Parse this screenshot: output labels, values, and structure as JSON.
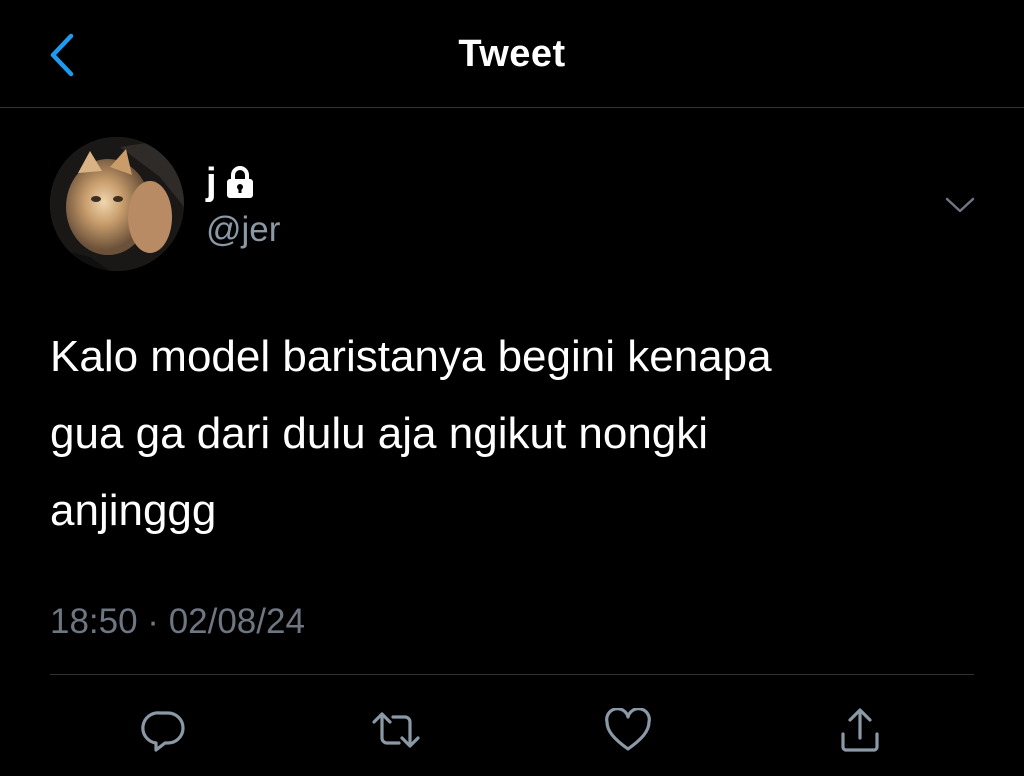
{
  "header": {
    "title": "Tweet",
    "back_icon": "chevron-left-icon",
    "accent_color": "#1d9bf0"
  },
  "tweet": {
    "display_name": "j",
    "protected_icon": "lock-icon",
    "handle": "@jer",
    "menu_icon": "chevron-down-icon",
    "text": "Kalo model baristanya begini kenapa\ngua ga dari dulu aja ngikut nongki\nanjinggg",
    "timestamp": "18:50 · 02/08/24"
  },
  "actions": [
    {
      "name": "reply",
      "icon": "reply-icon"
    },
    {
      "name": "retweet",
      "icon": "retweet-icon"
    },
    {
      "name": "like",
      "icon": "heart-icon"
    },
    {
      "name": "share",
      "icon": "share-icon"
    }
  ],
  "colors": {
    "background": "#000000",
    "text": "#ffffff",
    "secondary_text": "#8b98a5",
    "divider": "#2f3336"
  }
}
